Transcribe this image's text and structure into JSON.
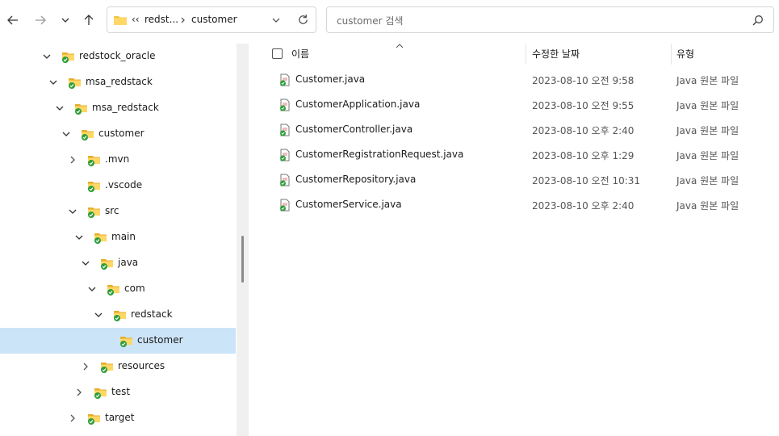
{
  "toolbar": {
    "address": {
      "overflow": "‹‹",
      "crumb1": "redst...",
      "crumb2": "customer"
    },
    "search_placeholder": "customer 검색"
  },
  "tree": [
    {
      "label": "redstock_oracle",
      "expanded": true
    },
    {
      "label": "msa_redstack",
      "expanded": true
    },
    {
      "label": "msa_redstack",
      "expanded": true
    },
    {
      "label": "customer",
      "expanded": true
    },
    {
      "label": ".mvn",
      "expanded": false
    },
    {
      "label": ".vscode",
      "expanded": null
    },
    {
      "label": "src",
      "expanded": true
    },
    {
      "label": "main",
      "expanded": true
    },
    {
      "label": "java",
      "expanded": true
    },
    {
      "label": "com",
      "expanded": true
    },
    {
      "label": "redstack",
      "expanded": true
    },
    {
      "label": "customer",
      "expanded": null,
      "selected": true
    },
    {
      "label": "resources",
      "expanded": false
    },
    {
      "label": "test",
      "expanded": false
    },
    {
      "label": "target",
      "expanded": false
    }
  ],
  "columns": {
    "name": "이름",
    "date": "수정한 날짜",
    "type": "유형"
  },
  "files": [
    {
      "name": "Customer.java",
      "date": "2023-08-10 오전 9:58",
      "type": "Java 원본 파일"
    },
    {
      "name": "CustomerApplication.java",
      "date": "2023-08-10 오전 9:55",
      "type": "Java 원본 파일"
    },
    {
      "name": "CustomerController.java",
      "date": "2023-08-10 오후 2:40",
      "type": "Java 원본 파일"
    },
    {
      "name": "CustomerRegistrationRequest.java",
      "date": "2023-08-10 오후 1:29",
      "type": "Java 원본 파일"
    },
    {
      "name": "CustomerRepository.java",
      "date": "2023-08-10 오전 10:31",
      "type": "Java 원본 파일"
    },
    {
      "name": "CustomerService.java",
      "date": "2023-08-10 오후 2:40",
      "type": "Java 원본 파일"
    }
  ],
  "colors": {
    "selection": "#cce4f7",
    "folder": "#f4c542",
    "sync": "#2e9e3a"
  }
}
